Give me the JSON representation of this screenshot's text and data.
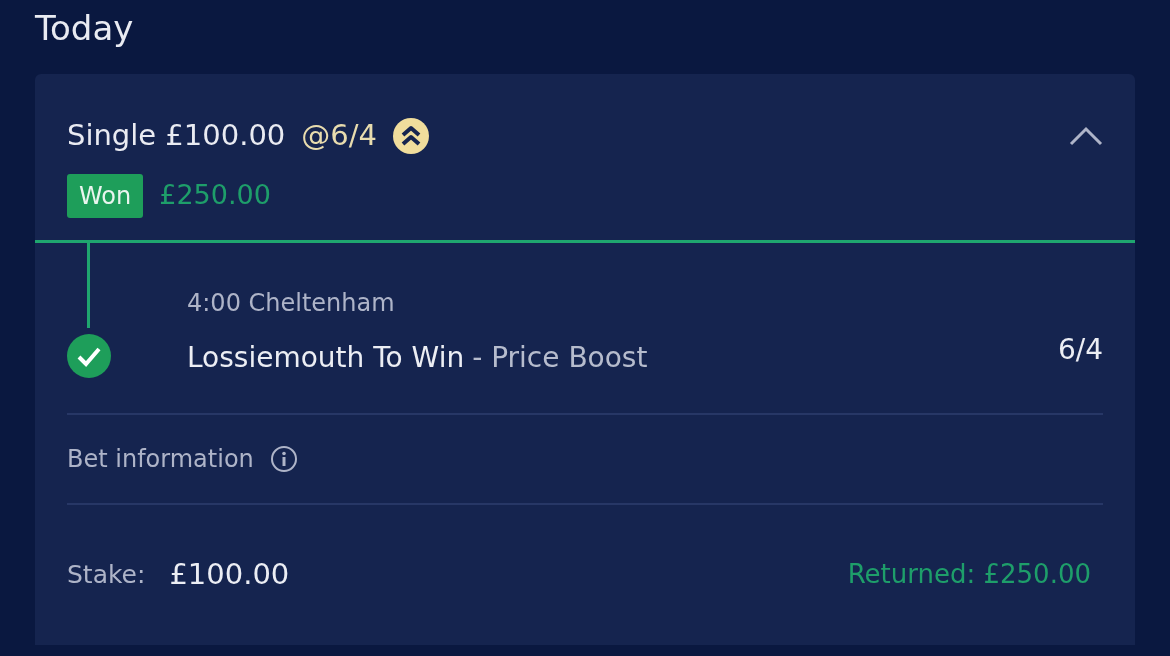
{
  "heading": "Today",
  "bet": {
    "title": "Single £100.00",
    "odds": "@6/4",
    "boosted": true,
    "expanded": true,
    "status": {
      "label": "Won",
      "kind": "won"
    },
    "return_amount": "£250.00"
  },
  "legs": [
    {
      "event": "4:00 Cheltenham",
      "selection": "Lossiemouth To Win",
      "boost_label": "- Price Boost",
      "odds": "6/4",
      "won": true
    }
  ],
  "info_label": "Bet information",
  "stake_label": "Stake:",
  "stake_value": "£100.00",
  "returned": "Returned: £250.00"
}
